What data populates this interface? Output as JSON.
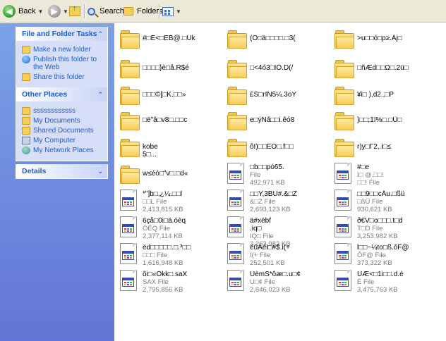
{
  "toolbar": {
    "back_label": "Back",
    "search_label": "Search",
    "folders_label": "Folders"
  },
  "tasks_panel": {
    "title": "File and Folder Tasks",
    "items": [
      {
        "label": "Make a new folder",
        "icon": "new-folder-icon"
      },
      {
        "label": "Publish this folder to the Web",
        "icon": "publish-web-icon"
      },
      {
        "label": "Share this folder",
        "icon": "share-folder-icon"
      }
    ]
  },
  "places_panel": {
    "title": "Other Places",
    "items": [
      {
        "label": "ssssssssssss",
        "icon": "folder-icon"
      },
      {
        "label": "My Documents",
        "icon": "my-documents-icon"
      },
      {
        "label": "Shared Documents",
        "icon": "shared-documents-icon"
      },
      {
        "label": "My Computer",
        "icon": "my-computer-icon"
      },
      {
        "label": "My Network Places",
        "icon": "my-network-places-icon"
      }
    ]
  },
  "details_panel": {
    "title": "Details"
  },
  "files": [
    {
      "type": "folder",
      "name": "#□É<□EB@.□Ùk"
    },
    {
      "type": "folder",
      "name": "(O□ä□□□□.□3("
    },
    {
      "type": "folder",
      "name": ">u□□ó□p≥.Äj□"
    },
    {
      "type": "folder",
      "name": "□□□□}è□å.R$é"
    },
    {
      "type": "folder",
      "name": "□<4ó3□IÖ.D(/"
    },
    {
      "type": "folder",
      "name": "□ñÆd□□Ω□.2ü□"
    },
    {
      "type": "folder",
      "name": "□□□©[□K.□□»"
    },
    {
      "type": "folder",
      "name": "£S□rIN5¼.3oY"
    },
    {
      "type": "folder",
      "name": "¥i□ ),d2.,□P"
    },
    {
      "type": "folder",
      "name": "□ë\"â□v8□.□□c"
    },
    {
      "type": "folder",
      "name": "e□ýÑã□□i.êó8"
    },
    {
      "type": "folder",
      "name": "}□□;1ï%□.□Ü□"
    },
    {
      "type": "folder",
      "name": "kobe\n5□..."
    },
    {
      "type": "folder",
      "name": "ôI)□□ÉÓ□.f□□"
    },
    {
      "type": "folder",
      "name": "r)y□Γ2,.i□≤"
    },
    {
      "type": "folder",
      "name": "w≤éó□\"v□.□d«"
    },
    {
      "type": "file",
      "name": "□b□□pó65.",
      "kind": "File",
      "size": "492,971 KB"
    },
    {
      "type": "file",
      "name": "#□e",
      "kind": "ï□ @.□□!",
      "size": "□□! File"
    },
    {
      "type": "file",
      "name": "*\"]b□,¿¼.□□l",
      "kind": "□□L File",
      "size": "2,413,815 KB"
    },
    {
      "type": "file",
      "name": "□□Y,3BU#.&□Z",
      "kind": "&□Z File",
      "size": "2,693,123 KB"
    },
    {
      "type": "file",
      "name": "□□9□□cÄu.□ßü",
      "kind": "□ßÜ File",
      "size": "930,621 KB"
    },
    {
      "type": "file",
      "name": "6çå□0i□ä.óèq",
      "kind": "ÓÈQ File",
      "size": "2,377,114 KB"
    },
    {
      "type": "file",
      "name": "ä#xëbf\n.iq□",
      "kind": "IQ□ File",
      "size": "3,263,982 KB"
    },
    {
      "type": "file",
      "name": "ð€V□o□□□.t□d",
      "kind": "T□D File",
      "size": "3,253,982 KB"
    },
    {
      "type": "file",
      "name": "ëd□□□□□.□.³□□",
      "kind": "□□□ File",
      "size": "1,616,948 KB"
    },
    {
      "type": "file",
      "name": "ëûÄéi□#$.i(+",
      "kind": "I(+ File",
      "size": "252,501 KB"
    },
    {
      "type": "file",
      "name": "l□□~¼to□ß.ôF@",
      "kind": "ÔF@ File",
      "size": "373,322 KB"
    },
    {
      "type": "file",
      "name": "õi□«Ôkk□.saX",
      "kind": "SAX File",
      "size": "2,795,856 KB"
    },
    {
      "type": "file",
      "name": "ÚèmS*ôæ□.u□¢",
      "kind": "U□¢ File",
      "size": "2,846,023 KB"
    },
    {
      "type": "file",
      "name": "ÙÆ<□1i□□.d.è",
      "kind": "È File",
      "size": "3,475,763 KB"
    }
  ],
  "colors": {
    "pane_link": "#215dc6",
    "pane_bg": "#6d8fd8",
    "meta_text": "#7a7a7a"
  }
}
